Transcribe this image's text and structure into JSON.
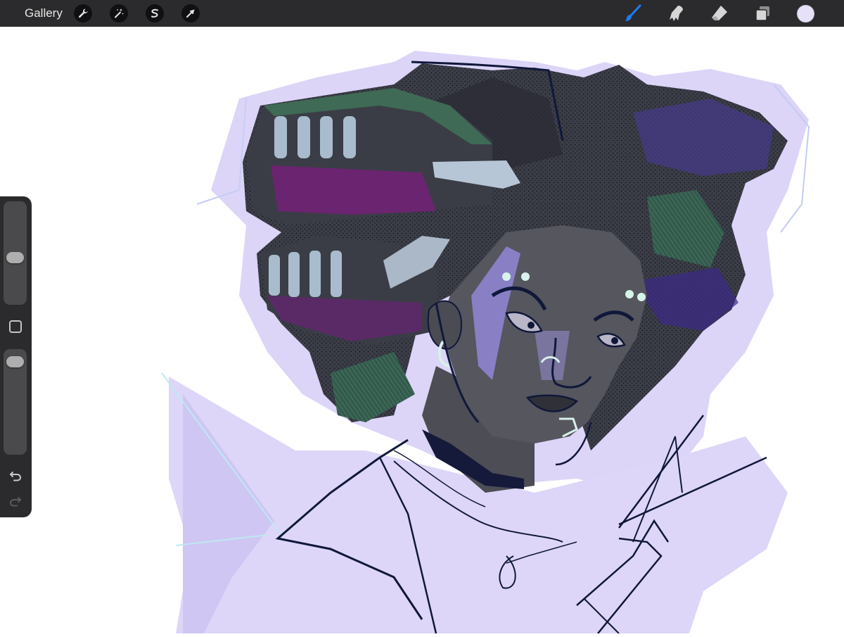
{
  "app": {
    "gallery_label": "Gallery"
  },
  "toolbar": {
    "left_tools": [
      {
        "icon": "wrench-icon",
        "name": "actions"
      },
      {
        "icon": "magic-wand-icon",
        "name": "adjustments"
      },
      {
        "icon": "selection-icon",
        "name": "selection"
      },
      {
        "icon": "transform-arrow-icon",
        "name": "transform"
      }
    ],
    "right_tools": [
      {
        "icon": "brush-icon",
        "name": "paint",
        "active": true
      },
      {
        "icon": "smudge-icon",
        "name": "smudge",
        "active": false
      },
      {
        "icon": "eraser-icon",
        "name": "eraser",
        "active": false
      },
      {
        "icon": "layers-icon",
        "name": "layers",
        "active": false
      }
    ],
    "current_color": "#e6e0f8"
  },
  "sidebar": {
    "brush_size_level": 0.45,
    "brush_opacity_level": 0.95,
    "icons": [
      "undo-icon",
      "redo-icon",
      "modify-square-icon"
    ]
  },
  "colors": {
    "toolbar_bg": "#2b2b2d",
    "accent_blue": "#1e7cf2",
    "lavender": "#dcd5f8",
    "ink": "#10183a"
  }
}
